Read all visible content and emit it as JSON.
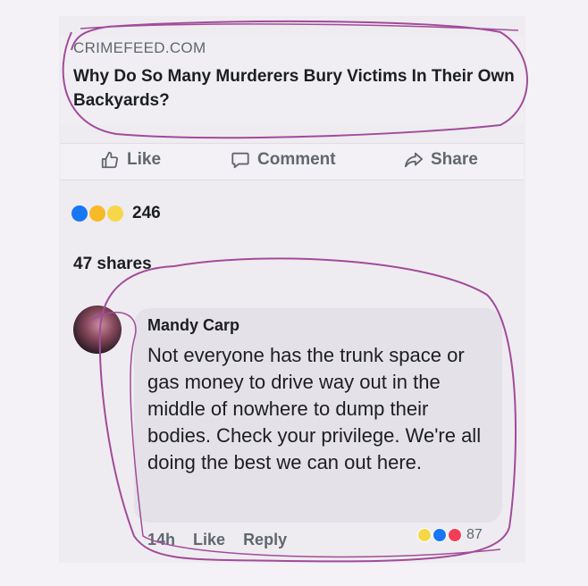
{
  "post": {
    "source": "CRIMEFEED.COM",
    "headline": "Why Do So Many Murderers Bury Victims In Their Own Backyards?",
    "actions": {
      "like": "Like",
      "comment": "Comment",
      "share": "Share"
    },
    "reaction_count": "246",
    "shares": "47 shares",
    "reaction_icons": [
      "like-reaction",
      "wow-reaction",
      "haha-reaction"
    ]
  },
  "comment": {
    "author": "Mandy Carp",
    "text": "Not everyone has the trunk space or gas money to drive way out in the middle of nowhere to dump their bodies. Check your privilege. We're all doing the best we can out here.",
    "time": "14h",
    "like": "Like",
    "reply": "Reply",
    "reaction_count": "87",
    "reaction_icons": [
      "haha-reaction",
      "like-reaction",
      "love-reaction"
    ]
  },
  "annotation_color": "#a24b9b",
  "colors": {
    "facebook_blue": "#1877f2",
    "secondary_text": "#606770"
  }
}
